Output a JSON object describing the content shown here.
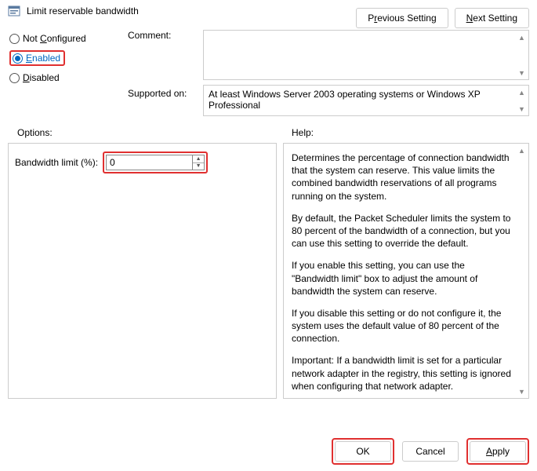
{
  "title": "Limit reservable bandwidth",
  "nav": {
    "prev_pre": "P",
    "prev_u": "r",
    "prev_post": "evious Setting",
    "next_pre": "",
    "next_u": "N",
    "next_post": "ext Setting"
  },
  "radios": {
    "not_configured_pre": "Not ",
    "not_configured_u": "C",
    "not_configured_post": "onfigured",
    "enabled_pre": "",
    "enabled_u": "E",
    "enabled_post": "nabled",
    "disabled_pre": "",
    "disabled_u": "D",
    "disabled_post": "isabled"
  },
  "labels": {
    "comment": "Comment:",
    "supported": "Supported on:",
    "options": "Options:",
    "help": "Help:"
  },
  "supported_text": "At least Windows Server 2003 operating systems or Windows XP Professional",
  "options": {
    "bw_label": "Bandwidth limit (%):",
    "bw_value": "0"
  },
  "help": {
    "p1": "Determines the percentage of connection bandwidth that the system can reserve. This value limits the combined bandwidth reservations of all programs running on the system.",
    "p2": "By default, the Packet Scheduler limits the system to 80 percent of the bandwidth of a connection, but you can use this setting to override the default.",
    "p3": "If you enable this setting, you can use the \"Bandwidth limit\" box to adjust the amount of bandwidth the system can reserve.",
    "p4": "If you disable this setting or do not configure it, the system uses the default value of 80 percent of the connection.",
    "p5": "Important: If a bandwidth limit is set for a particular network adapter in the registry, this setting is ignored when configuring that network adapter."
  },
  "footer": {
    "ok": "OK",
    "cancel": "Cancel",
    "apply_pre": "",
    "apply_u": "A",
    "apply_post": "pply"
  }
}
